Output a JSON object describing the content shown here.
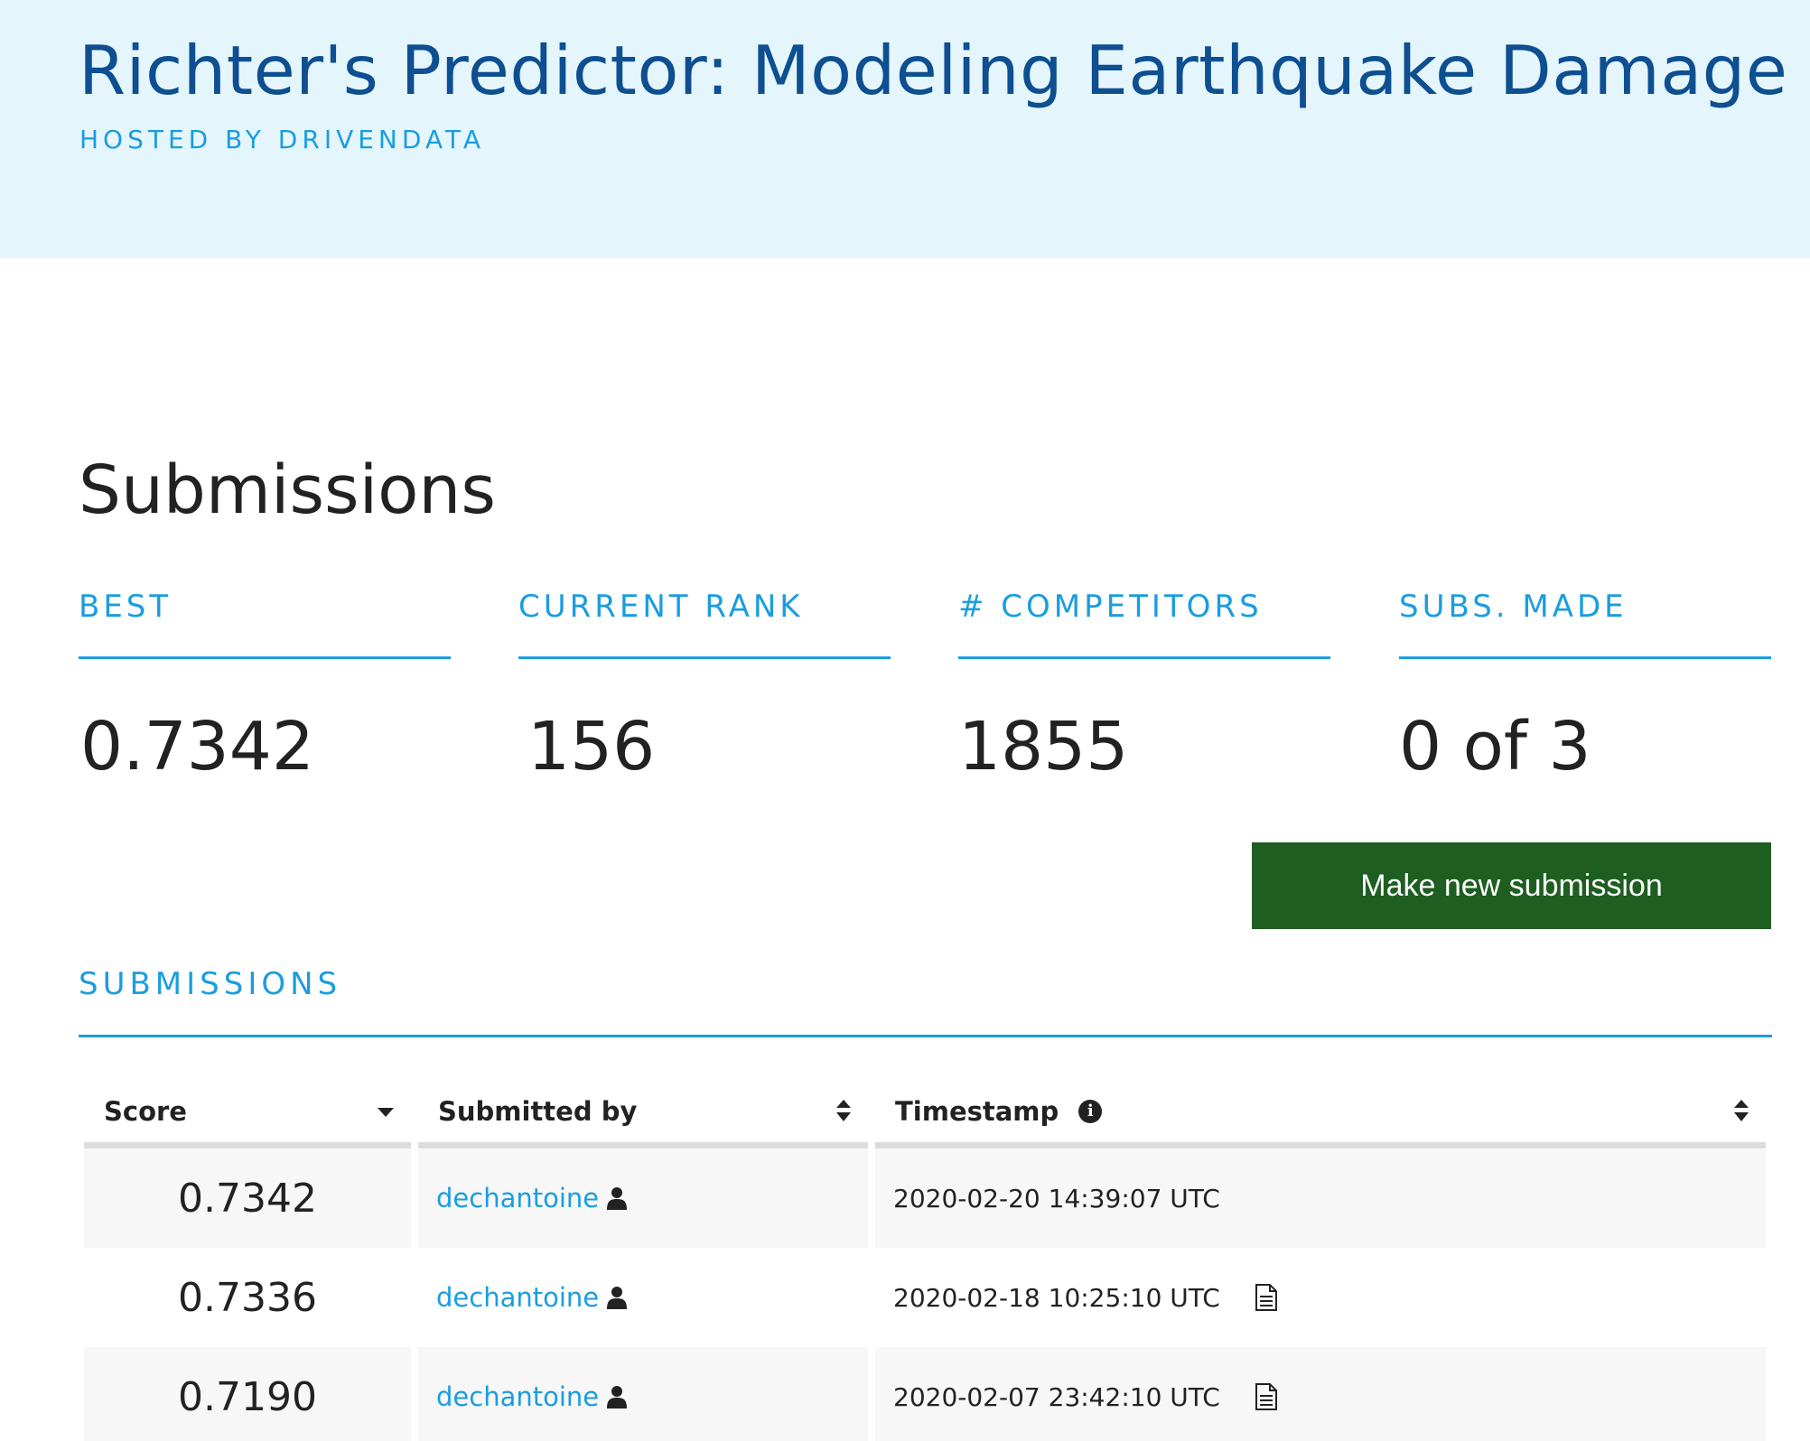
{
  "header": {
    "title": "Richter's Predictor: Modeling Earthquake Damage",
    "host": "HOSTED BY DRIVENDATA"
  },
  "page": {
    "title": "Submissions"
  },
  "stats": [
    {
      "label": "BEST",
      "value": "0.7342"
    },
    {
      "label": "CURRENT RANK",
      "value": "156"
    },
    {
      "label": "# COMPETITORS",
      "value": "1855"
    },
    {
      "label": "SUBS. MADE",
      "value": "0 of 3"
    }
  ],
  "actions": {
    "submit_label": "Make new submission"
  },
  "section": {
    "title": "SUBMISSIONS"
  },
  "table": {
    "columns": [
      {
        "label": "Score",
        "sort": "chevron-down-icon"
      },
      {
        "label": "Submitted by",
        "sort": "sort-icon"
      },
      {
        "label": "Timestamp",
        "sort": "sort-icon",
        "info": "info-icon"
      }
    ],
    "rows": [
      {
        "score": "0.7342",
        "user": "dechantoine",
        "timestamp": "2020-02-20 14:39:07 UTC",
        "has_file": false
      },
      {
        "score": "0.7336",
        "user": "dechantoine",
        "timestamp": "2020-02-18 10:25:10 UTC",
        "has_file": true
      },
      {
        "score": "0.7190",
        "user": "dechantoine",
        "timestamp": "2020-02-07 23:42:10 UTC",
        "has_file": true
      }
    ]
  },
  "colors": {
    "hero_bg": "#e5f5fc",
    "title": "#0d4f91",
    "accent": "#1a9de0",
    "button": "#1e5e21"
  }
}
